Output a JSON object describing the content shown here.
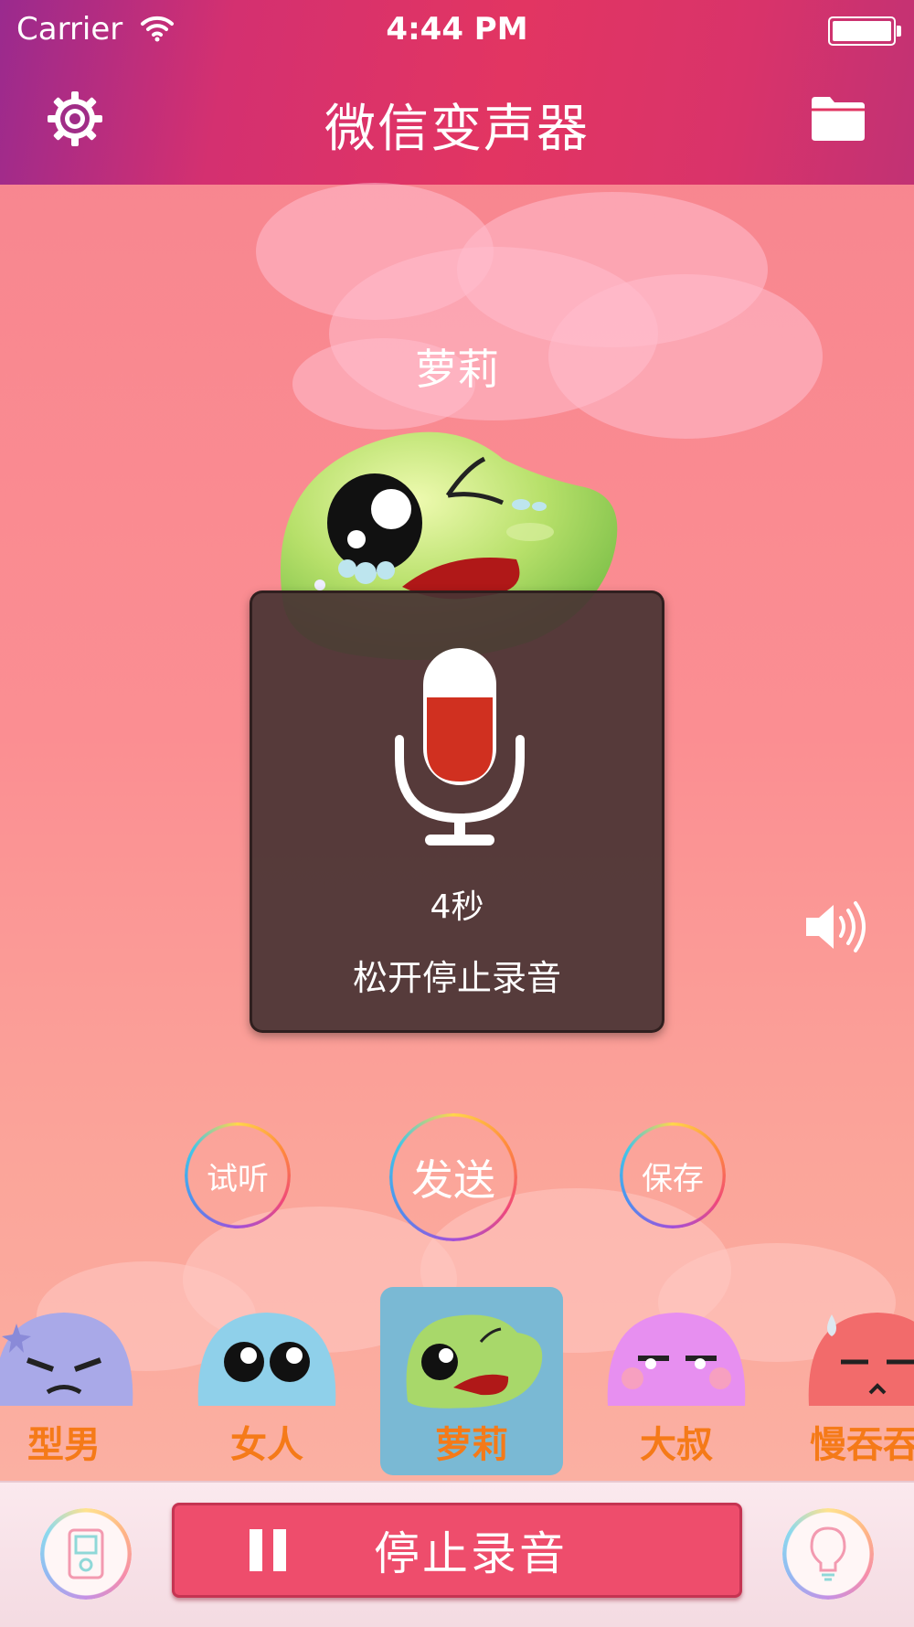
{
  "status_bar": {
    "carrier": "Carrier",
    "time": "4:44 PM"
  },
  "nav": {
    "title": "微信变声器",
    "left_icon": "settings-gear-icon",
    "right_icon": "folder-icon"
  },
  "current_voice": {
    "name": "萝莉"
  },
  "recording_hud": {
    "seconds": "4秒",
    "hint": "松开停止录音",
    "icon": "microphone-icon"
  },
  "speaker_icon": "speaker-volume-icon",
  "action_buttons": {
    "audition": "试听",
    "send": "发送",
    "save": "保存"
  },
  "characters": [
    {
      "label": "型男",
      "color": "#a9a9e8",
      "selected": false
    },
    {
      "label": "女人",
      "color": "#8fd0ea",
      "selected": false
    },
    {
      "label": "萝莉",
      "color": "#a8d86a",
      "selected": true
    },
    {
      "label": "大叔",
      "color": "#e78ff0",
      "selected": false
    },
    {
      "label": "慢吞吞",
      "color": "#f26b6b",
      "selected": false
    }
  ],
  "bottom_bar": {
    "stop_button": "停止录音",
    "left_icon": "player-device-icon",
    "right_icon": "lightbulb-icon"
  },
  "colors": {
    "accent": "#ee4d6c",
    "char_label": "#f57a18",
    "selected_bg": "#7ab9d4",
    "hud_bg": "#493434",
    "mic_fill": "#d03020"
  }
}
